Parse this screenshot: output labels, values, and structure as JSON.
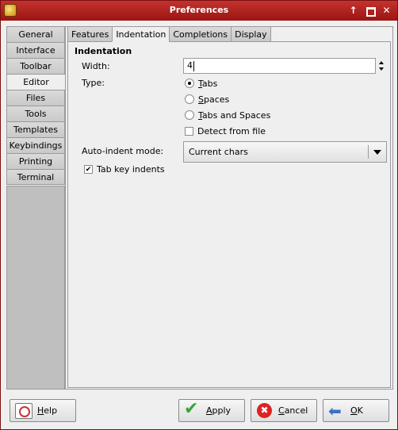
{
  "window": {
    "title": "Preferences"
  },
  "side_tabs": [
    "General",
    "Interface",
    "Toolbar",
    "Editor",
    "Files",
    "Tools",
    "Templates",
    "Keybindings",
    "Printing",
    "Terminal"
  ],
  "active_side_tab": "Editor",
  "top_tabs": [
    "Features",
    "Indentation",
    "Completions",
    "Display"
  ],
  "active_top_tab": "Indentation",
  "indentation": {
    "section_title": "Indentation",
    "width_label": "Width:",
    "width_value": "4",
    "type_label": "Type:",
    "type_options": [
      {
        "label": "Tabs",
        "mnemonic": "T",
        "rest": "abs",
        "selected": true
      },
      {
        "label": "Spaces",
        "mnemonic": "S",
        "rest": "paces",
        "selected": false
      },
      {
        "label": "Tabs and Spaces",
        "mnemonic": "T",
        "rest": "abs and Spaces",
        "selected": false
      }
    ],
    "detect_label": "Detect from file",
    "detect_checked": false,
    "autoindent_label": "Auto-indent mode:",
    "autoindent_value": "Current chars",
    "tabkey_label": "Tab key indents",
    "tabkey_checked": true
  },
  "buttons": {
    "help": {
      "mnemonic": "H",
      "rest": "elp"
    },
    "apply": {
      "mnemonic": "A",
      "rest": "pply"
    },
    "cancel": {
      "mnemonic": "C",
      "rest": "ancel"
    },
    "ok": {
      "mnemonic": "O",
      "rest": "K"
    }
  },
  "icons": {
    "app": "app-icon",
    "help": "help-icon",
    "apply": "checkmark-icon",
    "cancel": "cancel-icon",
    "ok": "ok-arrow-icon"
  },
  "colors": {
    "titlebar": "#b3201d",
    "apply_icon": "#3aa33a",
    "cancel_icon": "#d22222",
    "ok_icon": "#3b72c4"
  }
}
